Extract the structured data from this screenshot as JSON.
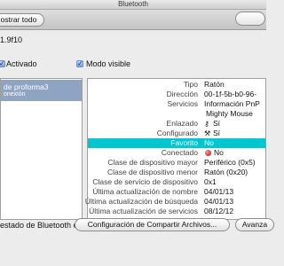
{
  "window": {
    "title": "Bluetooth"
  },
  "toolbar": {
    "show_all_label": "ostrar todo"
  },
  "close_label": "",
  "version_text": "1.9f10",
  "controls": {
    "activado_label": "Activado",
    "modo_visible_label": "Modo visible"
  },
  "device_list": [
    {
      "name": "de proforma3",
      "subtitle": "onexión"
    }
  ],
  "details": {
    "rows": [
      {
        "key": "Tipo",
        "value": "Ratón"
      },
      {
        "key": "Dirección",
        "value": "00-1f-5b-b0-96-"
      },
      {
        "key": "Servicios",
        "value": "Información PnP"
      },
      {
        "key": "",
        "value": "Mighty Mouse"
      },
      {
        "key": "Enlazado",
        "value": "Sí"
      },
      {
        "key": "Configurado",
        "value": "Sí"
      },
      {
        "key": "Favorito",
        "value": "No"
      },
      {
        "key": "Conectado",
        "value": "No"
      },
      {
        "key": "Clase de dispositivo mayor",
        "value": "Periférico (0x5)"
      },
      {
        "key": "Clase de dispositivo menor",
        "value": "Ratón (0x20)"
      },
      {
        "key": "Clase de servicio de dispositivo",
        "value": "0x1"
      },
      {
        "key": "Última actualización de nombre",
        "value": "04/01/13"
      },
      {
        "key": "Última actualización de búsqueda",
        "value": "04/01/13"
      },
      {
        "key": "Última actualización de servicios",
        "value": "08/12/12"
      }
    ]
  },
  "status_bar": {
    "menu_text": "estado de Bluetooth en la barra de menús"
  },
  "buttons": {
    "share": "Configuración de Compartir Archivos...",
    "advanced": "Avanza"
  },
  "colors": {
    "highlight": "#00c6cf",
    "selection": "#8fa4c3"
  },
  "icons": {
    "enlazado": "pairing-key-icon",
    "configurado": "tools-icon",
    "conectado": "red-status-dot-icon"
  }
}
